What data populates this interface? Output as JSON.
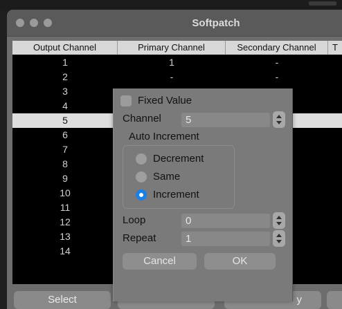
{
  "window": {
    "title": "Softpatch"
  },
  "table": {
    "headers": [
      "Output Channel",
      "Primary Channel",
      "Secondary Channel",
      "T"
    ],
    "rows": [
      {
        "output": "1",
        "primary": "1",
        "secondary": "-"
      },
      {
        "output": "2",
        "primary": "-",
        "secondary": "-"
      },
      {
        "output": "3",
        "primary": "",
        "secondary": ""
      },
      {
        "output": "4",
        "primary": "",
        "secondary": ""
      },
      {
        "output": "5",
        "primary": "",
        "secondary": ""
      },
      {
        "output": "6",
        "primary": "",
        "secondary": ""
      },
      {
        "output": "7",
        "primary": "",
        "secondary": ""
      },
      {
        "output": "8",
        "primary": "",
        "secondary": ""
      },
      {
        "output": "9",
        "primary": "",
        "secondary": ""
      },
      {
        "output": "10",
        "primary": "",
        "secondary": ""
      },
      {
        "output": "11",
        "primary": "",
        "secondary": ""
      },
      {
        "output": "12",
        "primary": "",
        "secondary": ""
      },
      {
        "output": "13",
        "primary": "",
        "secondary": ""
      },
      {
        "output": "14",
        "primary": "",
        "secondary": ""
      }
    ],
    "selected_output": "5"
  },
  "buttons": {
    "select": "Select",
    "b3_partial": "y"
  },
  "dialog": {
    "fixed_value_label": "Fixed Value",
    "fixed_value_checked": false,
    "channel_label": "Channel",
    "channel_value": "5",
    "auto_increment_label": "Auto Increment",
    "options": {
      "decrement": "Decrement",
      "same": "Same",
      "increment": "Increment"
    },
    "selected_option": "Increment",
    "loop_label": "Loop",
    "loop_value": "0",
    "repeat_label": "Repeat",
    "repeat_value": "1",
    "cancel_label": "Cancel",
    "ok_label": "OK"
  },
  "colors": {
    "accent": "#1a7fe6",
    "selected_row": "#dedede",
    "table_bg": "#000000"
  }
}
